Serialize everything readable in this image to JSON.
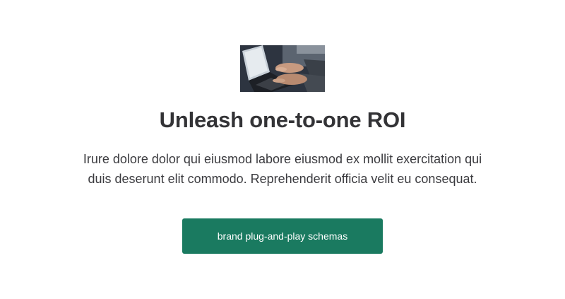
{
  "hero": {
    "image_icon": "laptop-typing-photo",
    "title": "Unleash one-to-one ROI",
    "description": "Irure dolore dolor qui eiusmod labore eiusmod ex mollit exercitation qui duis deserunt elit commodo. Reprehenderit officia velit eu consequat.",
    "cta_label": "brand plug-and-play schemas"
  },
  "colors": {
    "accent": "#1a7a60",
    "text": "#333336",
    "background": "#ffffff"
  }
}
